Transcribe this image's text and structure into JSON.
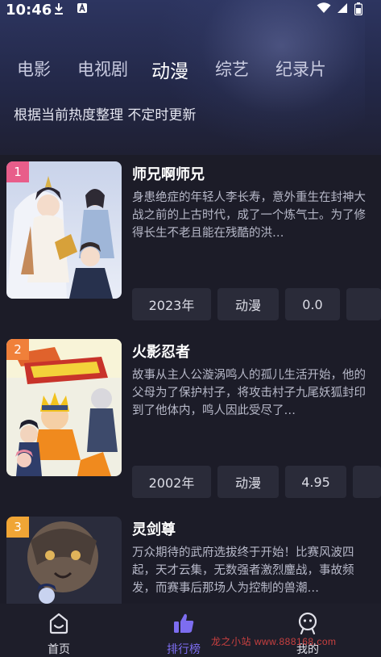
{
  "status_bar": {
    "time": "10:46"
  },
  "tabs": [
    {
      "label": "电影"
    },
    {
      "label": "电视剧"
    },
    {
      "label": "动漫",
      "active": true
    },
    {
      "label": "综艺"
    },
    {
      "label": "纪录片"
    }
  ],
  "subtitle": "根据当前热度整理 不定时更新",
  "items": [
    {
      "rank": "1",
      "rank_color": "#e85d8a",
      "title": "师兄啊师兄",
      "description": "身患绝症的年轻人李长寿，意外重生在封神大战之前的上古时代，成了一个炼气士。为了修得长生不老且能在残酷的洪…",
      "year": "2023年",
      "genre": "动漫",
      "score": "0.0"
    },
    {
      "rank": "2",
      "rank_color": "#f0803a",
      "title": "火影忍者",
      "description": "故事从主人公漩涡鸣人的孤儿生活开始，他的父母为了保护村子，将攻击村子九尾妖狐封印到了他体内，鸣人因此受尽了…",
      "year": "2002年",
      "genre": "动漫",
      "score": "4.95"
    },
    {
      "rank": "3",
      "rank_color": "#f0a535",
      "title": "灵剑尊",
      "description": "万众期待的武府选拔终于开始！比赛风波四起，天才云集，无数强者激烈鏖战，事故频发，而赛事后那场人为控制的兽潮…",
      "year": "",
      "genre": "",
      "score": ""
    }
  ],
  "bottom_nav": [
    {
      "label": "首页",
      "icon": "home-icon"
    },
    {
      "label": "排行榜",
      "icon": "thumbs-up-icon",
      "active": true
    },
    {
      "label": "我的",
      "icon": "profile-icon"
    }
  ],
  "watermark": "龙之小站 www.888168.com",
  "colors": {
    "accent": "#7d6df0",
    "background": "#1c1c28",
    "chip": "#2a2b39"
  }
}
